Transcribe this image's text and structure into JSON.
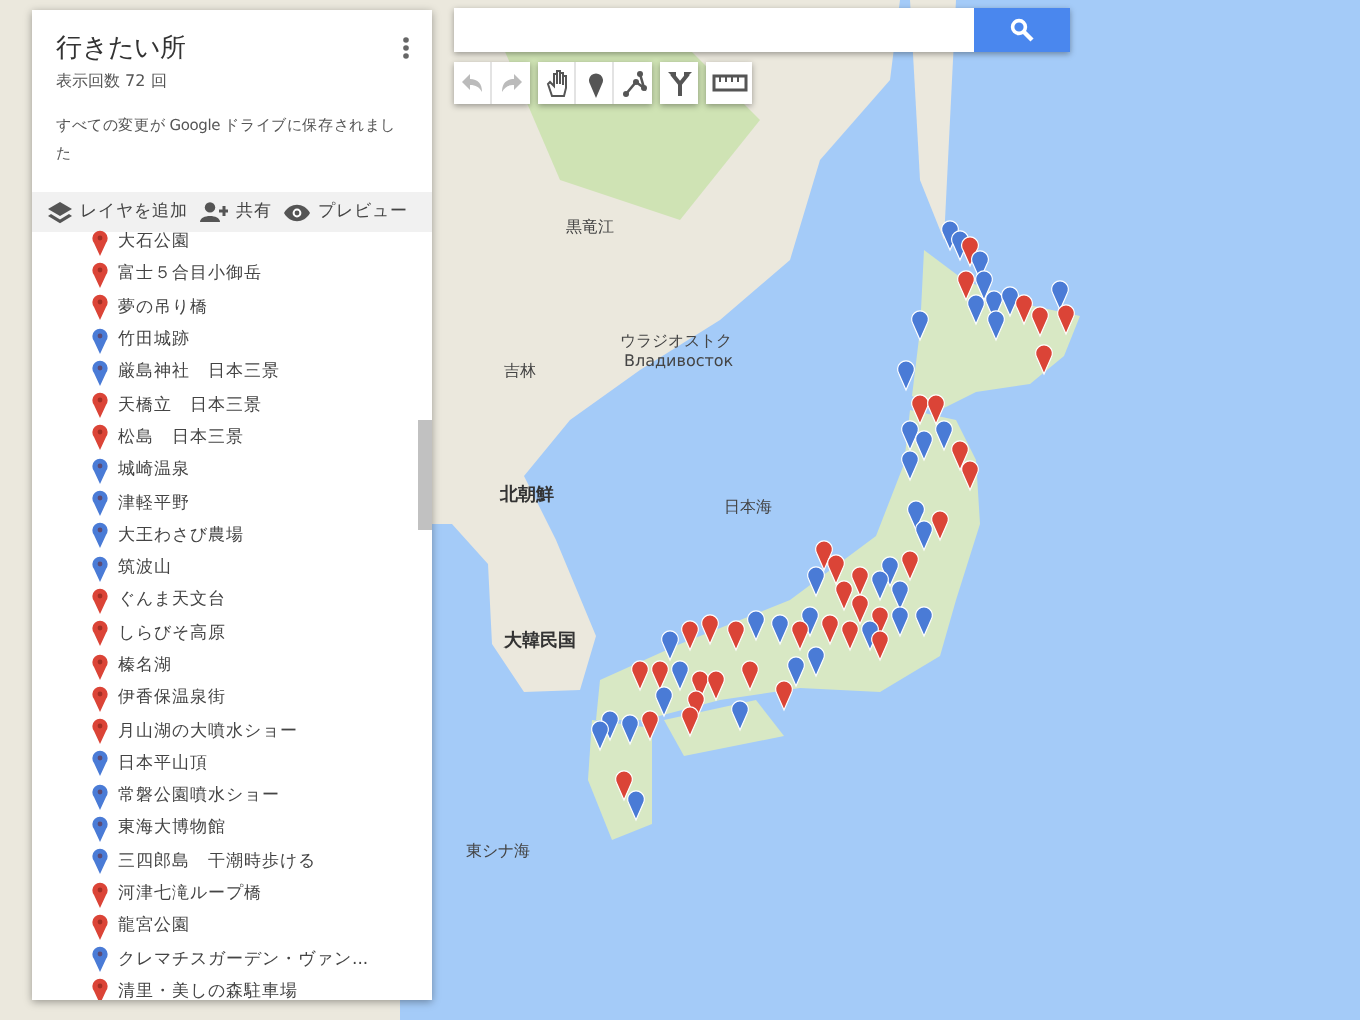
{
  "panel": {
    "title": "行きたい所",
    "views": "表示回数 72 回",
    "save_status": "すべての変更が Google ドライブに保存されました",
    "actions": [
      {
        "kind": "layer",
        "label": "レイヤを追加"
      },
      {
        "kind": "share",
        "label": "共有"
      },
      {
        "kind": "preview",
        "label": "プレビュー"
      }
    ],
    "places": [
      {
        "name": "大石公園",
        "color": "#db4437"
      },
      {
        "name": "富士５合目小御岳",
        "color": "#db4437"
      },
      {
        "name": "夢の吊り橋",
        "color": "#db4437"
      },
      {
        "name": "竹田城跡",
        "color": "#4a7bd6"
      },
      {
        "name": "厳島神社　日本三景",
        "color": "#4a7bd6"
      },
      {
        "name": "天橋立　日本三景",
        "color": "#db4437"
      },
      {
        "name": "松島　日本三景",
        "color": "#db4437"
      },
      {
        "name": "城崎温泉",
        "color": "#4a7bd6"
      },
      {
        "name": "津軽平野",
        "color": "#4a7bd6"
      },
      {
        "name": "大王わさび農場",
        "color": "#4a7bd6"
      },
      {
        "name": "筑波山",
        "color": "#4a7bd6"
      },
      {
        "name": "ぐんま天文台",
        "color": "#db4437"
      },
      {
        "name": "しらびそ高原",
        "color": "#db4437"
      },
      {
        "name": "榛名湖",
        "color": "#db4437"
      },
      {
        "name": "伊香保温泉街",
        "color": "#db4437"
      },
      {
        "name": "月山湖の大噴水ショー",
        "color": "#db4437"
      },
      {
        "name": "日本平山頂",
        "color": "#4a7bd6"
      },
      {
        "name": "常磐公園噴水ショー",
        "color": "#4a7bd6"
      },
      {
        "name": "東海大博物館",
        "color": "#4a7bd6"
      },
      {
        "name": "三四郎島　干潮時歩ける",
        "color": "#4a7bd6"
      },
      {
        "name": "河津七滝ループ橋",
        "color": "#db4437"
      },
      {
        "name": "龍宮公園",
        "color": "#db4437"
      },
      {
        "name": "クレマチスガーデン・ヴァン...",
        "color": "#4a7bd6"
      },
      {
        "name": "清里・美しの森駐車場",
        "color": "#db4437"
      }
    ]
  },
  "toolbar": [
    {
      "kind": "undo",
      "disabled": true
    },
    {
      "kind": "redo",
      "disabled": true
    },
    {
      "kind": "hand",
      "disabled": false
    },
    {
      "kind": "marker",
      "disabled": false
    },
    {
      "kind": "line",
      "disabled": false
    },
    {
      "kind": "route",
      "disabled": false
    },
    {
      "kind": "ruler",
      "disabled": false
    }
  ],
  "map_labels": [
    "黒竜江",
    "吉林",
    "ウラジオストク",
    "Владивосток",
    "北朝鮮",
    "日本海",
    "大韓民国",
    "東シナ海"
  ]
}
